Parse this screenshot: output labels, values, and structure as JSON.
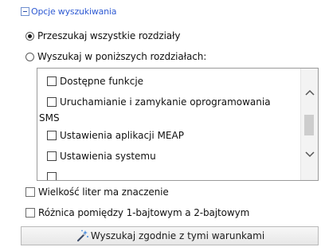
{
  "group": {
    "title": "Opcje wyszukiwania"
  },
  "scope": {
    "search_all_label": "Przeszukaj wszystkie rozdziały",
    "search_selected_label": "Wyszukaj w poniższych rozdziałach:",
    "selected": "all"
  },
  "chapters": {
    "items": [
      {
        "label": "Dostępne funkcje"
      },
      {
        "label": "Uruchamianie i zamykanie oprogramowania"
      },
      {
        "label": "SMS"
      },
      {
        "label": "Ustawienia aplikacji MEAP"
      },
      {
        "label": "Ustawienia systemu"
      }
    ]
  },
  "options": {
    "match_case_label": "Wielkość liter ma znaczenie",
    "byte_width_label": "Różnica pomiędzy 1-bajtowym a 2-bajtowym"
  },
  "action": {
    "search_button_label": "Wyszukaj zgodnie z tymi warunkami"
  },
  "colors": {
    "group_title": "#2f5bd3",
    "collapse_box_border": "#6f8fcf"
  }
}
